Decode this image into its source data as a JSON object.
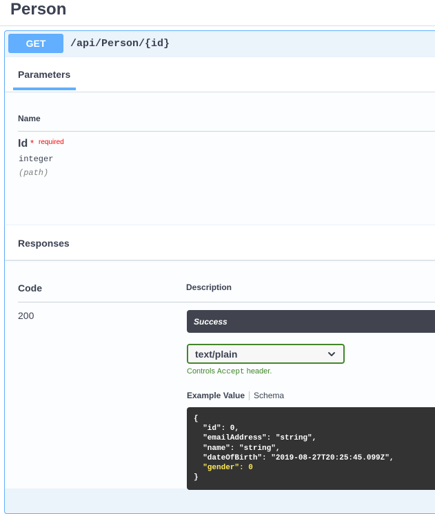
{
  "page": {
    "title": "Person"
  },
  "operation": {
    "method": "GET",
    "path": "/api/Person/{id}"
  },
  "parameters": {
    "tab_label": "Parameters",
    "column_name": "Name",
    "items": [
      {
        "name": "Id",
        "required_star": "*",
        "required_text": "required",
        "type": "integer",
        "in": "(path)"
      }
    ]
  },
  "responses": {
    "title": "Responses",
    "col_code": "Code",
    "col_description": "Description",
    "rows": [
      {
        "code": "200",
        "description": "Success",
        "media_type": "text/plain",
        "controls_prefix": "Controls ",
        "controls_code": "Accept",
        "controls_suffix": " header.",
        "example_tab": "Example Value",
        "schema_tab": "Schema",
        "example_lines": [
          "{",
          "  \"id\": 0,",
          "  \"emailAddress\": \"string\",",
          "  \"name\": \"string\",",
          "  \"dateOfBirth\": \"2019-08-27T20:25:45.099Z\",",
          "  \"gender\": 0",
          "}"
        ]
      }
    ]
  },
  "colors": {
    "get": "#61affe",
    "success_bg": "#41444e",
    "select_border": "#41862a",
    "highlight": "#e0e800"
  }
}
